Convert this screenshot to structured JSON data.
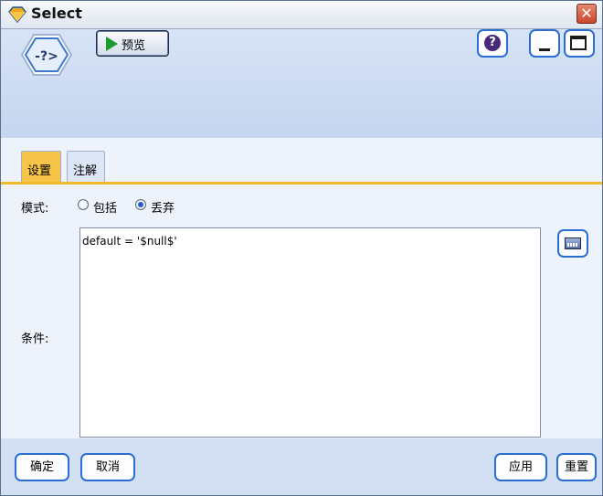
{
  "window": {
    "title": "Select",
    "close_glyph": "✕"
  },
  "toolbar": {
    "preview_label": "预览",
    "help_glyph": "?",
    "icons": {
      "node": "select-node-icon",
      "help": "help-icon",
      "minimize": "minimize-icon",
      "maximize": "maximize-icon"
    }
  },
  "node_icon_text": "-?>",
  "tabs": [
    {
      "label": "设置",
      "active": true
    },
    {
      "label": "注解",
      "active": false
    }
  ],
  "settings": {
    "mode_label": "模式:",
    "mode_options": [
      {
        "label": "包括",
        "selected": false
      },
      {
        "label": "丢弃",
        "selected": true
      }
    ],
    "condition_label": "条件:",
    "condition_value": "default = '$null$'"
  },
  "footer": {
    "ok_label": "确定",
    "cancel_label": "取消",
    "apply_label": "应用",
    "reset_label": "重置"
  },
  "colors": {
    "active_tab": "#f5c449",
    "accent_border": "#2a6fd0",
    "header_bg": "#c6d6ef",
    "footer_bg": "#d3dff3"
  }
}
